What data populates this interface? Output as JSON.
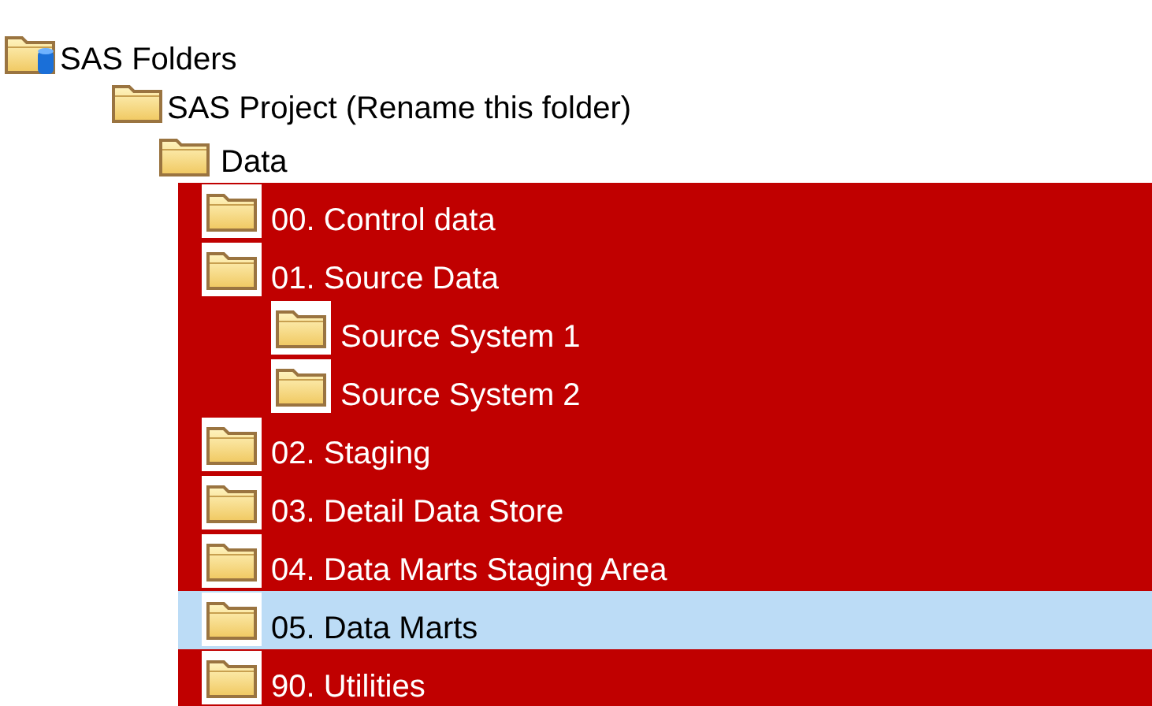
{
  "tree": [
    {
      "label": "SAS Folders",
      "kind": "repository",
      "selected": false,
      "highlighted": false,
      "children": [
        {
          "label": "SAS Project (Rename this folder)",
          "kind": "folder",
          "selected": false,
          "highlighted": false,
          "children": [
            {
              "label": "Data",
              "kind": "folder",
              "selected": false,
              "highlighted": false,
              "children": [
                {
                  "label": "00. Control data",
                  "kind": "folder",
                  "selected": false,
                  "highlighted": true
                },
                {
                  "label": "01. Source Data",
                  "kind": "folder",
                  "selected": false,
                  "highlighted": true,
                  "children": [
                    {
                      "label": "Source System 1",
                      "kind": "folder",
                      "selected": false,
                      "highlighted": true
                    },
                    {
                      "label": "Source System 2",
                      "kind": "folder",
                      "selected": false,
                      "highlighted": true
                    }
                  ]
                },
                {
                  "label": "02. Staging",
                  "kind": "folder",
                  "selected": false,
                  "highlighted": true
                },
                {
                  "label": "03. Detail Data Store",
                  "kind": "folder",
                  "selected": false,
                  "highlighted": true
                },
                {
                  "label": "04. Data Marts Staging Area",
                  "kind": "folder",
                  "selected": false,
                  "highlighted": true
                },
                {
                  "label": "05. Data Marts",
                  "kind": "folder",
                  "selected": true,
                  "highlighted": true
                },
                {
                  "label": "90. Utilities",
                  "kind": "folder",
                  "selected": false,
                  "highlighted": true
                }
              ]
            }
          ]
        }
      ]
    }
  ]
}
